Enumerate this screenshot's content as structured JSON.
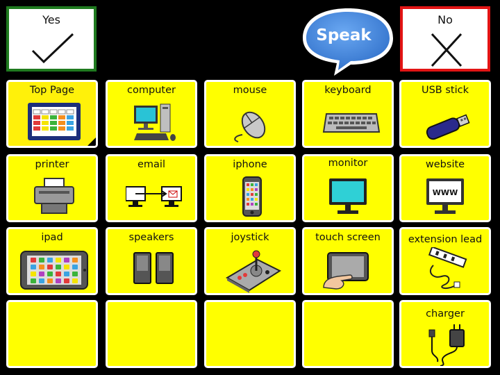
{
  "top": {
    "yes_label": "Yes",
    "no_label": "No",
    "speak_label": "Speak"
  },
  "grid": {
    "row1": [
      "Top Page",
      "computer",
      "mouse",
      "keyboard",
      "USB stick"
    ],
    "row2": [
      "printer",
      "email",
      "iphone",
      "monitor",
      "website"
    ],
    "row3": [
      "ipad",
      "speakers",
      "joystick",
      "touch screen",
      "extension lead"
    ],
    "row4": [
      "",
      "",
      "",
      "",
      "charger"
    ],
    "website_screen_text": "WWW"
  },
  "colors": {
    "cell_bg": "#ffff00",
    "yes_border": "#1f7a1f",
    "no_border": "#e21414",
    "speak_bubble": "#4a8ee6"
  }
}
